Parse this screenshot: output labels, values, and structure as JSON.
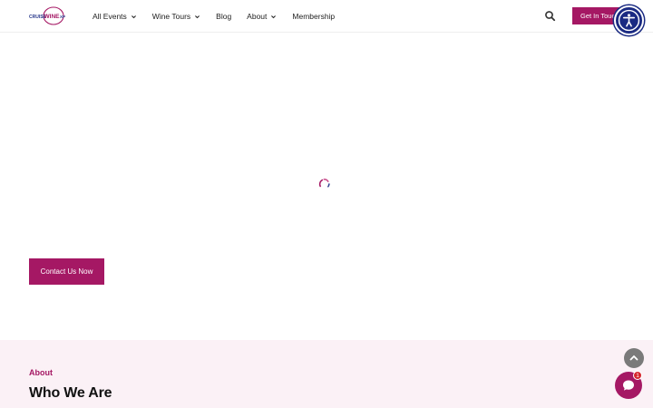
{
  "brand": {
    "logo_text_left": "CRUISE",
    "logo_text_mid": "WINE",
    "logo_text_right": "XP",
    "accent": "#a51864"
  },
  "nav": {
    "items": [
      {
        "label": "All Events",
        "has_dropdown": true
      },
      {
        "label": "Wine Tours",
        "has_dropdown": true
      },
      {
        "label": "Blog",
        "has_dropdown": false
      },
      {
        "label": "About",
        "has_dropdown": true
      },
      {
        "label": "Membership",
        "has_dropdown": false
      }
    ],
    "cta_label": "Get In Touch"
  },
  "icons": {
    "search": "search-icon",
    "accessibility": "accessibility-icon",
    "spinner": "loading-spinner-icon",
    "scroll_top": "chevron-up-icon",
    "chat": "chat-icon"
  },
  "contact": {
    "button_label": "Contact Us Now"
  },
  "about": {
    "kicker": "About",
    "title": "Who We Are"
  },
  "chat": {
    "badge_count": "1"
  }
}
